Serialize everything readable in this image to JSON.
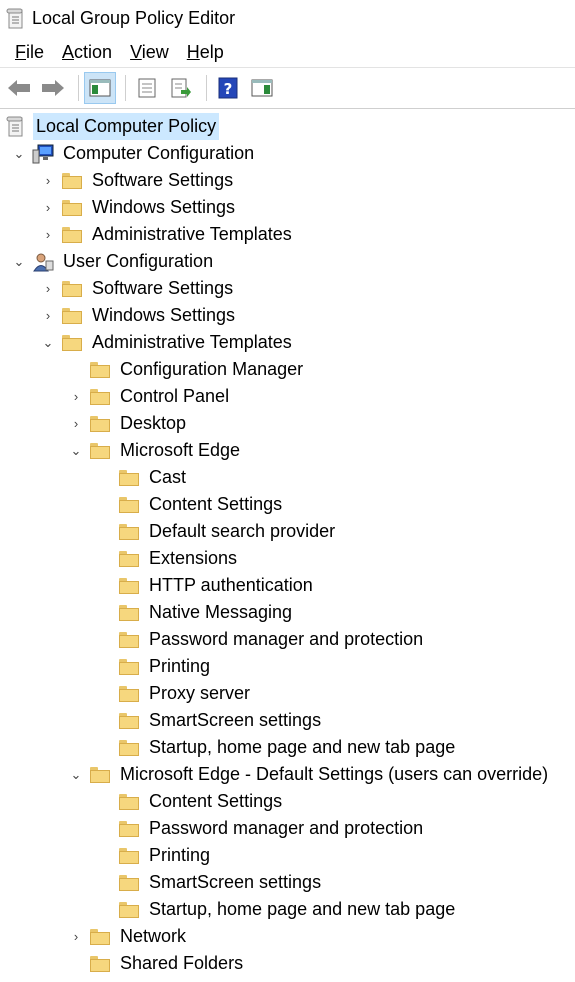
{
  "window": {
    "title": "Local Group Policy Editor"
  },
  "menu": [
    {
      "label": "File",
      "underline": "F",
      "rest": "ile"
    },
    {
      "label": "Action",
      "underline": "A",
      "rest": "ction"
    },
    {
      "label": "View",
      "underline": "V",
      "rest": "iew"
    },
    {
      "label": "Help",
      "underline": "H",
      "rest": "elp"
    }
  ],
  "toolbar": {
    "buttons": [
      "back-arrow-icon",
      "forward-arrow-icon",
      "show-hide-console-tree-icon",
      "properties-icon",
      "export-list-icon",
      "help-icon",
      "show-action-pane-icon"
    ]
  },
  "tree": {
    "root": "Local Computer Policy",
    "computer_configuration": {
      "label": "Computer Configuration",
      "children": [
        "Software Settings",
        "Windows Settings",
        "Administrative Templates"
      ]
    },
    "user_configuration": {
      "label": "User Configuration",
      "software_settings": "Software Settings",
      "windows_settings": "Windows Settings",
      "administrative_templates": {
        "label": "Administrative Templates",
        "configuration_manager": "Configuration Manager",
        "control_panel": "Control Panel",
        "desktop": "Desktop",
        "microsoft_edge": {
          "label": "Microsoft Edge",
          "children": [
            "Cast",
            "Content Settings",
            "Default search provider",
            "Extensions",
            "HTTP authentication",
            "Native Messaging",
            "Password manager and protection",
            "Printing",
            "Proxy server",
            "SmartScreen settings",
            "Startup, home page and new tab page"
          ]
        },
        "microsoft_edge_default": {
          "label": "Microsoft Edge - Default Settings (users can override)",
          "children": [
            "Content Settings",
            "Password manager and protection",
            "Printing",
            "SmartScreen settings",
            "Startup, home page and new tab page"
          ]
        },
        "network": "Network",
        "shared_folders": "Shared Folders"
      }
    }
  }
}
